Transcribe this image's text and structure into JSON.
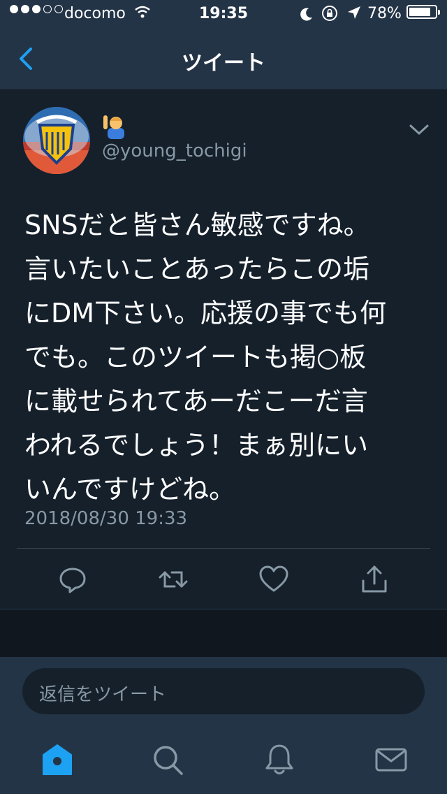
{
  "status_bar": {
    "carrier": "docomo",
    "time": "19:35",
    "battery_percent": "78%",
    "battery_level": 0.78,
    "signal_bars": 3
  },
  "nav": {
    "title": "ツイート",
    "back_icon": "chevron-left-icon"
  },
  "tweet": {
    "author_handle": "@young_tochigi",
    "author_display_emoji_icon": "person-raising-hand-emoji-icon",
    "text_lines": [
      "SNSだと皆さん敏感ですね。",
      "言いたいことあったらこの垢",
      "にDM下さい。応援の事でも何",
      "でも。このツイートも掲○板",
      "に載せられてあーだこーだ言",
      "われるでしょう！まぁ別にい",
      "いんですけどね。"
    ],
    "timestamp": "2018/08/30 19:33",
    "actions": [
      "reply-icon",
      "retweet-icon",
      "like-icon",
      "share-icon"
    ]
  },
  "reply": {
    "placeholder": "返信をツイート"
  },
  "tab_bar": {
    "tabs": [
      "home-icon",
      "search-icon",
      "notifications-icon",
      "messages-icon"
    ],
    "active": "home-icon"
  },
  "colors": {
    "background": "#15202b",
    "bar_background": "#243447",
    "accent": "#1da1f2",
    "secondary_text": "#8899a6"
  }
}
